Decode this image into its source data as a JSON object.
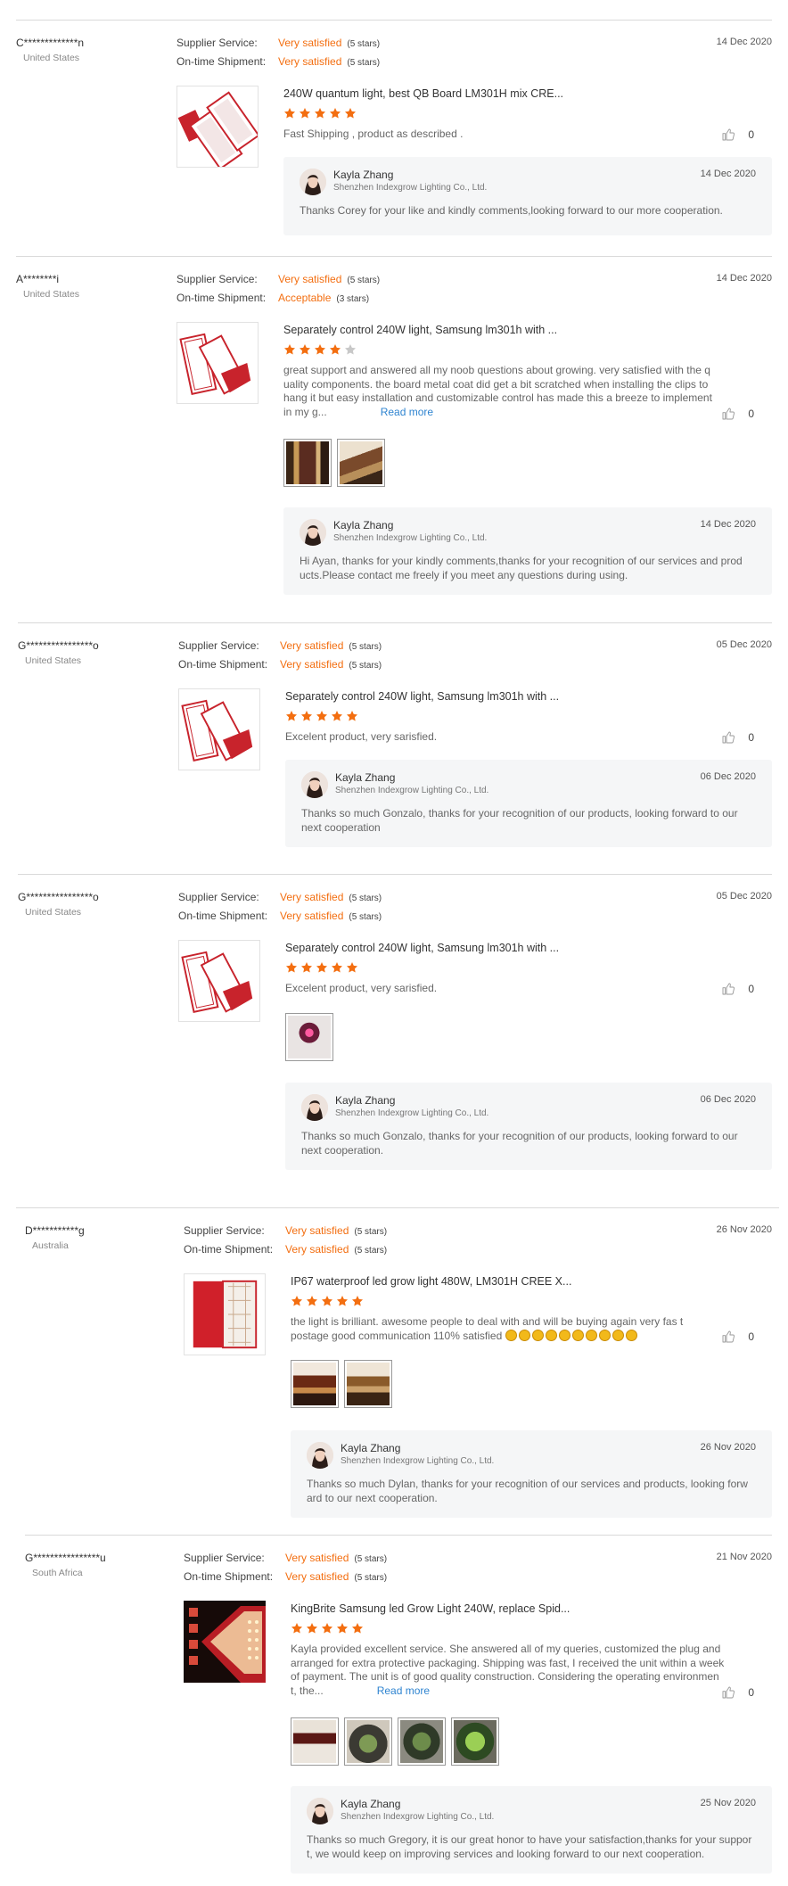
{
  "labels": {
    "supplier_service": "Supplier Service:",
    "on_time_shipment": "On-time Shipment:"
  },
  "colors": {
    "accent": "#f36e10",
    "star_empty": "#c8c8c8",
    "link": "#2f84d0",
    "reply_bg": "#f5f6f7"
  },
  "icons": {
    "like": "thumbs-up-icon",
    "star": "star-icon"
  },
  "reviews": [
    {
      "buyer": "C*************n",
      "country": "United States",
      "supplier_value": "Very satisfied",
      "supplier_stars": "(5 stars)",
      "shipment_value": "Very satisfied",
      "shipment_stars": "(5 stars)",
      "date": "14 Dec 2020",
      "product": "240W quantum light, best QB Board LM301H mix CRE...",
      "rating": 5,
      "text": "Fast Shipping , product as described .",
      "read_more": "",
      "likes": "0",
      "photos": [],
      "reply": {
        "name": "Kayla Zhang",
        "company": "Shenzhen Indexgrow Lighting Co., Ltd.",
        "date": "14 Dec 2020",
        "text": "Thanks Corey for your like and kindly comments,looking forward to our more cooperation."
      }
    },
    {
      "buyer": "A********i",
      "country": "United States",
      "supplier_value": "Very satisfied",
      "supplier_stars": "(5 stars)",
      "shipment_value": "Acceptable",
      "shipment_stars": "(3 stars)",
      "date": "14 Dec 2020",
      "product": "Separately control 240W light, Samsung lm301h with ...",
      "rating": 4,
      "text": "great support and answered all my noob questions about growing. very satisfied with the q uality components. the board metal coat did get a bit scratched when installing the clips to hang it but easy installation and customizable control has made this a breeze to implement in my g...",
      "read_more": "Read more",
      "likes": "0",
      "photos": [
        "photo-1",
        "photo-2"
      ],
      "reply": {
        "name": "Kayla Zhang",
        "company": "Shenzhen Indexgrow Lighting Co., Ltd.",
        "date": "14 Dec 2020",
        "text": "Hi Ayan, thanks for your kindly comments,thanks for your recognition of our services and prod ucts.Please contact me freely if you meet any questions during using."
      }
    },
    {
      "buyer": "G****************o",
      "country": "United States",
      "supplier_value": "Very satisfied",
      "supplier_stars": "(5 stars)",
      "shipment_value": "Very satisfied",
      "shipment_stars": "(5 stars)",
      "date": "05 Dec 2020",
      "product": "Separately control 240W light, Samsung lm301h with ...",
      "rating": 5,
      "text": "Excelent product, very sarisfied.",
      "read_more": "",
      "likes": "0",
      "photos": [],
      "reply": {
        "name": "Kayla Zhang",
        "company": "Shenzhen Indexgrow Lighting Co., Ltd.",
        "date": "06 Dec 2020",
        "text": "Thanks so much Gonzalo, thanks for your recognition of our products, looking forward to our next cooperation"
      }
    },
    {
      "buyer": "G****************o",
      "country": "United States",
      "supplier_value": "Very satisfied",
      "supplier_stars": "(5 stars)",
      "shipment_value": "Very satisfied",
      "shipment_stars": "(5 stars)",
      "date": "05 Dec 2020",
      "product": "Separately control 240W light, Samsung lm301h with ...",
      "rating": 5,
      "text": "Excelent product, very sarisfied.",
      "read_more": "",
      "likes": "0",
      "photos": [
        "photo-1"
      ],
      "reply": {
        "name": "Kayla Zhang",
        "company": "Shenzhen Indexgrow Lighting Co., Ltd.",
        "date": "06 Dec 2020",
        "text": "Thanks so much Gonzalo, thanks for your recognition of our products, looking forward to our next cooperation."
      }
    },
    {
      "buyer": "D***********g",
      "country": "Australia",
      "supplier_value": "Very satisfied",
      "supplier_stars": "(5 stars)",
      "shipment_value": "Very satisfied",
      "shipment_stars": "(5 stars)",
      "date": "26 Nov 2020",
      "product": "IP67 waterproof led grow light 480W, LM301H CREE X...",
      "rating": 5,
      "text": "the light is brilliant. awesome people to deal with and will be buying again very fas t postage good communication 110% satisfied",
      "read_more": "",
      "likes": "0",
      "photos": [
        "photo-1",
        "photo-2"
      ],
      "reply": {
        "name": "Kayla Zhang",
        "company": "Shenzhen Indexgrow Lighting Co., Ltd.",
        "date": "26 Nov 2020",
        "text": "Thanks so much Dylan, thanks for your recognition of our services and products, looking forw ard to our next cooperation."
      }
    },
    {
      "buyer": "G****************u",
      "country": "South Africa",
      "supplier_value": "Very satisfied",
      "supplier_stars": "(5 stars)",
      "shipment_value": "Very satisfied",
      "shipment_stars": "(5 stars)",
      "date": "21 Nov 2020",
      "product": "KingBrite Samsung led Grow Light 240W, replace Spid...",
      "rating": 5,
      "text": "Kayla provided excellent service. She answered all of my queries, customized the plug and arranged for extra protective packaging. Shipping was fast, I received the unit within a week of payment. The unit is of good quality construction. Considering the operating environmen t, the...",
      "read_more": "Read more",
      "likes": "0",
      "photos": [
        "photo-1",
        "photo-2",
        "photo-3",
        "photo-4"
      ],
      "reply": {
        "name": "Kayla Zhang",
        "company": "Shenzhen Indexgrow Lighting Co., Ltd.",
        "date": "25 Nov 2020",
        "text": "Thanks so much Gregory, it is our great honor to have your satisfaction,thanks for your suppor t, we would keep on improving services and looking forward to our next cooperation."
      }
    }
  ]
}
